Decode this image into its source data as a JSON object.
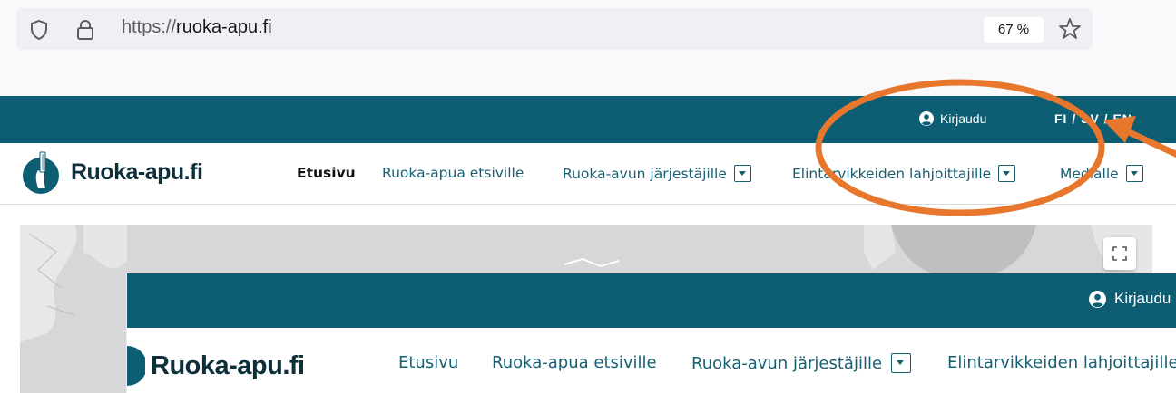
{
  "browser": {
    "url_prefix": "https://",
    "url_host": "ruoka-apu.fi",
    "zoom": "67 %"
  },
  "site": {
    "login_label": "Kirjaudu",
    "lang_label": "FI / SV / EN",
    "brand": "Ruoka-apu.fi",
    "nav": [
      {
        "label": "Etusivu",
        "active": true
      },
      {
        "label": "Ruoka-apua etsiville",
        "active": false
      },
      {
        "label": "Ruoka-avun järjestäjille",
        "active": false,
        "dropdown": true
      },
      {
        "label": "Elintarvikkeiden lahjoittajille",
        "active": false,
        "dropdown": true
      },
      {
        "label": "Medialle",
        "active": false,
        "dropdown": true
      }
    ]
  },
  "inset": {
    "login_label": "Kirjaudu",
    "brand": "Ruoka-apu.fi",
    "nav": [
      {
        "label": "Etusivu"
      },
      {
        "label": "Ruoka-apua etsiville"
      },
      {
        "label": "Ruoka-avun järjestäjille",
        "dropdown": true
      },
      {
        "label": "Elintarvikkeiden lahjoittajille"
      }
    ]
  },
  "colors": {
    "brand_teal": "#0e5e73",
    "annotation_orange": "#e8772e"
  },
  "icons": [
    "shield-icon",
    "lock-icon",
    "star-icon",
    "user-circle-icon",
    "fullscreen-icon",
    "dropdown-icon"
  ]
}
